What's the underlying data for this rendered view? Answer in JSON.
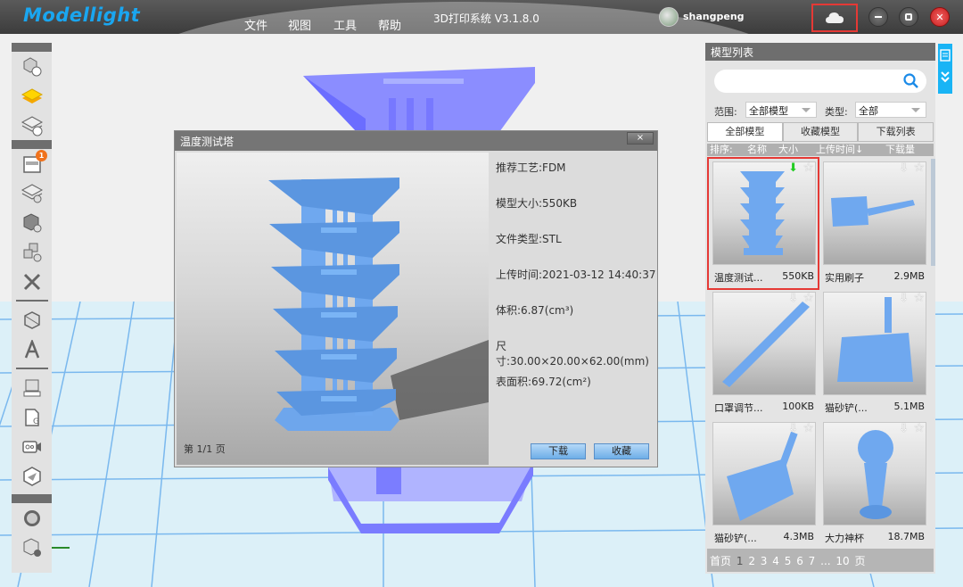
{
  "titlebar": {
    "logo": "Modellight",
    "menu": [
      "文件",
      "视图",
      "工具",
      "帮助"
    ],
    "app_title": "3D打印系统 V3.1.8.0",
    "username": "shangpeng",
    "cloud_icon": "cloud-icon",
    "window_controls": [
      "minimize",
      "maximize",
      "close"
    ]
  },
  "toolbar": {
    "groups": [
      [
        "import-model-icon",
        "layers-active-icon",
        "layers-import-icon"
      ],
      [
        "printer-icon",
        "slice-settings-icon",
        "model-settings-icon",
        "multi-model-settings-icon",
        "tools-icon"
      ],
      [
        "view-cube-icon",
        "text-3d-icon"
      ],
      [
        "measure-icon",
        "gcode-file-icon",
        "camera-icon",
        "send-icon"
      ],
      [
        "preview-icon",
        "model-repair-icon"
      ]
    ],
    "printer_badge": "1"
  },
  "dialog": {
    "title": "温度测试塔",
    "close_label": "×",
    "page_indicator": "第 1/1 页",
    "info": [
      "推荐工艺:FDM",
      "模型大小:550KB",
      "文件类型:STL",
      "上传时间:2021-03-12 14:40:37",
      "体积:6.87(cm³)",
      "尺寸:30.00×20.00×62.00(mm)",
      "表面积:69.72(cm²)"
    ],
    "download_label": "下载",
    "favorite_label": "收藏"
  },
  "panel": {
    "title": "模型列表",
    "search_placeholder": "",
    "range_label": "范围:",
    "range_value": "全部模型",
    "type_label": "类型:",
    "type_value": "全部",
    "tabs": [
      "全部模型",
      "收藏模型",
      "下载列表"
    ],
    "sort": {
      "label": "排序:",
      "name": "名称",
      "size": "大小",
      "upload_time": "上传时间↓",
      "downloads": "下载量"
    },
    "models": [
      {
        "name": "温度测试...",
        "size": "550KB",
        "downloaded": true,
        "selected": true
      },
      {
        "name": "实用刷子",
        "size": "2.9MB",
        "downloaded": false,
        "selected": false
      },
      {
        "name": "口罩调节...",
        "size": "100KB",
        "downloaded": false,
        "selected": false
      },
      {
        "name": "猫砂铲(...",
        "size": "5.1MB",
        "downloaded": false,
        "selected": false
      },
      {
        "name": "猫砂铲(...",
        "size": "4.3MB",
        "downloaded": false,
        "selected": false
      },
      {
        "name": "大力神杯",
        "size": "18.7MB",
        "downloaded": false,
        "selected": false
      }
    ],
    "pager": {
      "first": "首页",
      "pages": [
        "1",
        "2",
        "3",
        "4",
        "5",
        "6",
        "7",
        "...",
        "10"
      ],
      "current": "1",
      "suffix": "页"
    }
  },
  "colors": {
    "accent": "#19b4f5",
    "model_blue": "#6fa8ef",
    "highlight_red": "#e53935",
    "download_green": "#22cc22"
  }
}
